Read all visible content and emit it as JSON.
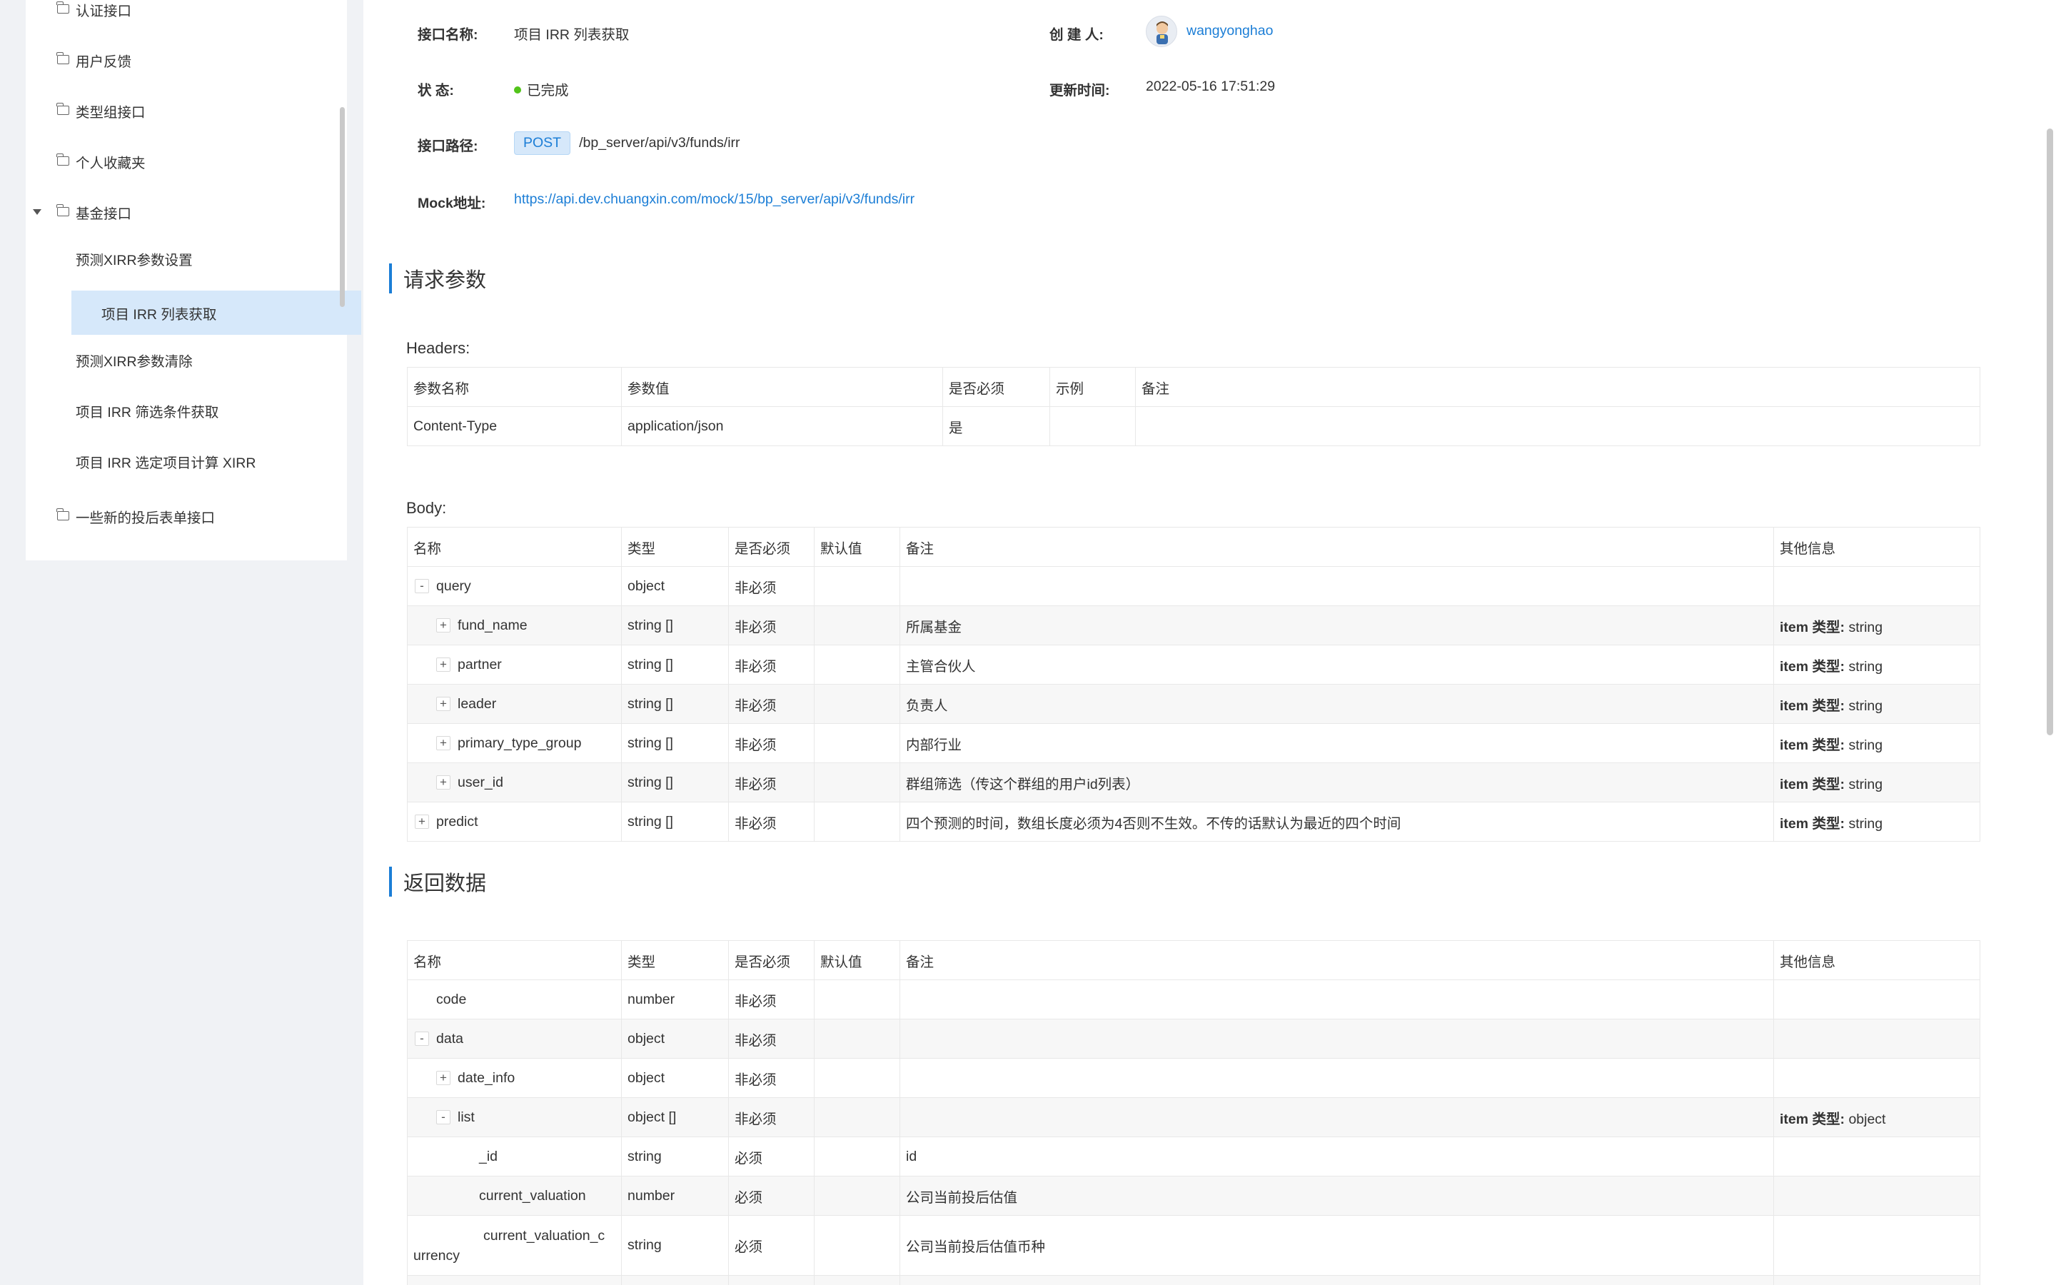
{
  "sidebar": {
    "items": [
      {
        "label": "认证接口"
      },
      {
        "label": "用户反馈"
      },
      {
        "label": "类型组接口"
      },
      {
        "label": "个人收藏夹"
      },
      {
        "label": "基金接口"
      },
      {
        "label": "预测XIRR参数设置"
      },
      {
        "label": "项目 IRR 列表获取"
      },
      {
        "label": "预测XIRR参数清除"
      },
      {
        "label": "项目 IRR 筛选条件获取"
      },
      {
        "label": "项目 IRR 选定项目计算 XIRR"
      },
      {
        "label": "一些新的投后表单接口"
      }
    ]
  },
  "info": {
    "name_label": "接口名称:",
    "name_value": "项目 IRR 列表获取",
    "creator_label": "创 建 人:",
    "creator_value": "wangyonghao",
    "status_label": "状      态:",
    "status_value": "已完成",
    "updated_label": "更新时间:",
    "updated_value": "2022-05-16 17:51:29",
    "path_label": "接口路径:",
    "method": "POST",
    "path_value": "/bp_server/api/v3/funds/irr",
    "mock_label": "Mock地址:",
    "mock_value": "https://api.dev.chuangxin.com/mock/15/bp_server/api/v3/funds/irr"
  },
  "request": {
    "title": "请求参数",
    "headers_title": "Headers:",
    "headers_columns": [
      "参数名称",
      "参数值",
      "是否必须",
      "示例",
      "备注"
    ],
    "headers_rows": [
      [
        "Content-Type",
        "application/json",
        "是",
        "",
        ""
      ]
    ],
    "body_title": "Body:",
    "body_columns": [
      "名称",
      "类型",
      "是否必须",
      "默认值",
      "备注",
      "其他信息"
    ],
    "body_rows": [
      {
        "toggle": "-",
        "name": "query",
        "type": "object",
        "req": "非必须",
        "default": "",
        "note": "",
        "other_key": "",
        "other_val": ""
      },
      {
        "toggle": "+",
        "name": "fund_name",
        "type": "string []",
        "req": "非必须",
        "default": "",
        "note": "所属基金",
        "other_key": "item 类型:",
        "other_val": "string"
      },
      {
        "toggle": "+",
        "name": "partner",
        "type": "string []",
        "req": "非必须",
        "default": "",
        "note": "主管合伙人",
        "other_key": "item 类型:",
        "other_val": "string"
      },
      {
        "toggle": "+",
        "name": "leader",
        "type": "string []",
        "req": "非必须",
        "default": "",
        "note": "负责人",
        "other_key": "item 类型:",
        "other_val": "string"
      },
      {
        "toggle": "+",
        "name": "primary_type_group",
        "type": "string []",
        "req": "非必须",
        "default": "",
        "note": "内部行业",
        "other_key": "item 类型:",
        "other_val": "string"
      },
      {
        "toggle": "+",
        "name": "user_id",
        "type": "string []",
        "req": "非必须",
        "default": "",
        "note": "群组筛选（传这个群组的用户id列表）",
        "other_key": "item 类型:",
        "other_val": "string"
      },
      {
        "toggle": "+",
        "name": "predict",
        "type": "string []",
        "req": "非必须",
        "default": "",
        "note": "四个预测的时间，数组长度必须为4否则不生效。不传的话默认为最近的四个时间",
        "other_key": "item 类型:",
        "other_val": "string"
      }
    ]
  },
  "response": {
    "title": "返回数据",
    "columns": [
      "名称",
      "类型",
      "是否必须",
      "默认值",
      "备注",
      "其他信息"
    ],
    "rows": [
      {
        "toggle": "",
        "name": "code",
        "type": "number",
        "req": "非必须",
        "default": "",
        "note": "",
        "other_key": "",
        "other_val": ""
      },
      {
        "toggle": "-",
        "name": "data",
        "type": "object",
        "req": "非必须",
        "default": "",
        "note": "",
        "other_key": "",
        "other_val": ""
      },
      {
        "toggle": "+",
        "name": "date_info",
        "type": "object",
        "req": "非必须",
        "default": "",
        "note": "",
        "other_key": "",
        "other_val": ""
      },
      {
        "toggle": "-",
        "name": "list",
        "type": "object []",
        "req": "非必须",
        "default": "",
        "note": "",
        "other_key": "item 类型:",
        "other_val": "object"
      },
      {
        "toggle": "",
        "name": "_id",
        "type": "string",
        "req": "必须",
        "default": "",
        "note": "id",
        "other_key": "",
        "other_val": ""
      },
      {
        "toggle": "",
        "name": "current_valuation",
        "type": "number",
        "req": "必须",
        "default": "",
        "note": "公司当前投后估值",
        "other_key": "",
        "other_val": ""
      },
      {
        "toggle": "",
        "name_part1": "current_valuation_c",
        "name_part2": "urrency",
        "type": "string",
        "req": "必须",
        "default": "",
        "note": "公司当前投后估值币种",
        "other_key": "",
        "other_val": ""
      }
    ]
  }
}
